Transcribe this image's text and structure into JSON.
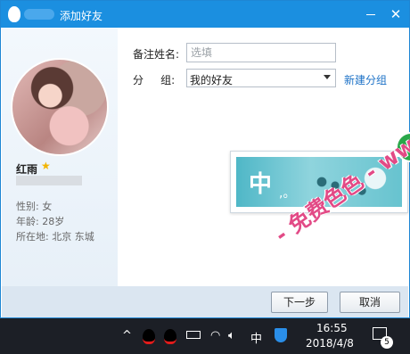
{
  "window": {
    "title": "添加好友",
    "minimize_label": "—",
    "close_label": "✕"
  },
  "profile": {
    "nickname": "红雨",
    "star_icon": "★",
    "gender": "性别: 女",
    "age": "年龄: 28岁",
    "location": "所在地: 北京  东城"
  },
  "form": {
    "remark_label": "备注姓名:",
    "remark_placeholder": "选填",
    "group_label": "分     组:",
    "group_value": "我的好友",
    "new_group_link": "新建分组"
  },
  "ad": {
    "char": "中",
    "dots": ",。"
  },
  "buttons": {
    "next": "下一步",
    "cancel": "取消"
  },
  "watermark": {
    "text": "- 免费色色 - www.MFsese.com"
  },
  "taskbar": {
    "chevron": "^",
    "ime": "中",
    "time": "16:55",
    "date": "2018/4/8",
    "notification_count": "5"
  }
}
